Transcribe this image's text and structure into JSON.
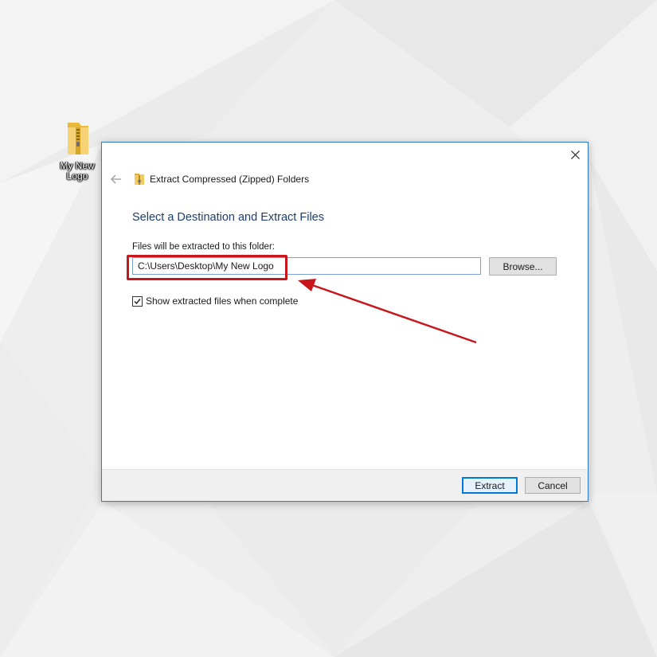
{
  "desktop": {
    "icon_label": "My New Logo",
    "icon": "zip-folder-icon"
  },
  "dialog": {
    "back_icon": "back-arrow-icon",
    "wizard_icon": "zip-folder-icon",
    "close_icon": "close-icon",
    "title": "Extract Compressed (Zipped) Folders",
    "heading": "Select a Destination and Extract Files",
    "destination_label": "Files will be extracted to this folder:",
    "destination_value": "C:\\Users\\Desktop\\My New Logo",
    "browse_label": "Browse...",
    "show_files_label": "Show extracted files when complete",
    "show_files_checked": true,
    "extract_label": "Extract",
    "cancel_label": "Cancel"
  },
  "colors": {
    "heading": "#1e3e6e",
    "dialog_border": "#2f7bc7",
    "default_button_border": "#0078d7",
    "annotation": "#c8161d"
  }
}
